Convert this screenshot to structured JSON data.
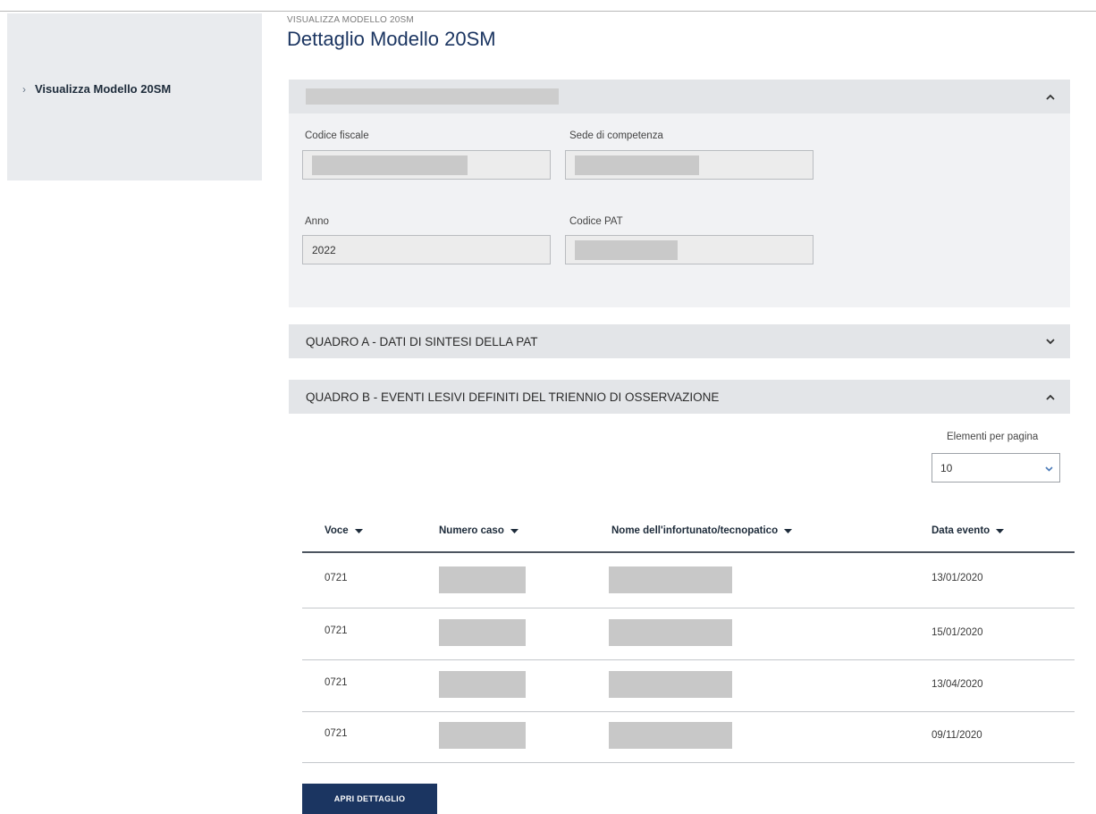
{
  "sidebar": {
    "items": [
      {
        "label": "Visualizza Modello 20SM"
      }
    ]
  },
  "header": {
    "breadcrumb": "VISUALIZZA MODELLO 20SM",
    "title": "Dettaglio Modello 20SM"
  },
  "general_panel": {
    "fields": {
      "codice_fiscale": {
        "label": "Codice fiscale"
      },
      "sede": {
        "label": "Sede di competenza"
      },
      "anno": {
        "label": "Anno",
        "value": "2022"
      },
      "codice_pat": {
        "label": "Codice PAT"
      }
    }
  },
  "quadro_a": {
    "title": "QUADRO A - DATI DI SINTESI DELLA PAT"
  },
  "quadro_b": {
    "title": "QUADRO B - EVENTI LESIVI DEFINITI DEL TRIENNIO DI OSSERVAZIONE",
    "per_page_label": "Elementi per pagina",
    "per_page_value": "10",
    "columns": [
      "Voce",
      "Numero caso",
      "Nome dell'infortunato/tecnopatico",
      "Data evento"
    ],
    "rows": [
      {
        "voce": "0721",
        "data": "13/01/2020"
      },
      {
        "voce": "0721",
        "data": "15/01/2020"
      },
      {
        "voce": "0721",
        "data": "13/04/2020"
      },
      {
        "voce": "0721",
        "data": "09/11/2020"
      }
    ],
    "button_label": "APRI DETTAGLIO"
  },
  "colors": {
    "primary": "#1b3561",
    "panel_header": "#e3e5e8",
    "panel_body": "#f1f2f4",
    "sidebar": "#e9ebee",
    "redaction": "#c9c9c9"
  }
}
